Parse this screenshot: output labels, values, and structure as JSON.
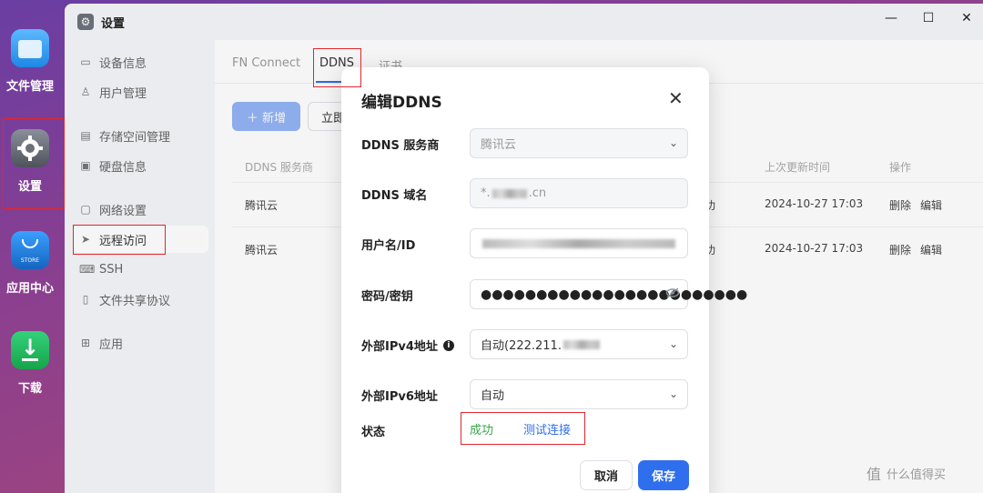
{
  "dock": {
    "apps": [
      {
        "label": "文件管理",
        "icon": "folder-icon"
      },
      {
        "label": "设置",
        "icon": "gear-icon"
      },
      {
        "label": "应用中心",
        "icon": "store-icon",
        "badge": "STORE"
      },
      {
        "label": "下载",
        "icon": "download-icon"
      }
    ]
  },
  "window": {
    "title": "设置",
    "controls": {
      "close": "✕",
      "maximize": "☐",
      "minimize": "—"
    }
  },
  "sidebar": {
    "items": [
      {
        "label": "设备信息",
        "icon": "monitor-icon"
      },
      {
        "label": "用户管理",
        "icon": "user-icon"
      },
      {
        "label": "存储空间管理",
        "icon": "storage-icon"
      },
      {
        "label": "硬盘信息",
        "icon": "disk-icon"
      },
      {
        "label": "网络设置",
        "icon": "network-icon"
      },
      {
        "label": "远程访问",
        "icon": "send-icon"
      },
      {
        "label": "SSH",
        "icon": "terminal-icon"
      },
      {
        "label": "文件共享协议",
        "icon": "document-icon"
      },
      {
        "label": "应用",
        "icon": "apps-grid-icon"
      }
    ],
    "active": "远程访问"
  },
  "tabs": [
    "FN Connect",
    "DDNS",
    "证书"
  ],
  "active_tab": "DDNS",
  "toolbar": {
    "add_label": "＋ 新增",
    "now_label": "立即"
  },
  "table": {
    "headers": [
      "DDNS 服务商",
      "上次更新时间",
      "操作"
    ],
    "rows": [
      {
        "provider": "腾讯云",
        "status_tail": "功",
        "updated": "2024-10-27 17:03",
        "delete": "删除",
        "edit": "编辑"
      },
      {
        "provider": "腾讯云",
        "status_tail": "功",
        "updated": "2024-10-27 17:03",
        "delete": "删除",
        "edit": "编辑"
      }
    ]
  },
  "modal": {
    "title": "编辑DDNS",
    "close": "✕",
    "fields": {
      "provider": {
        "label": "DDNS 服务商",
        "value": "腾讯云"
      },
      "domain": {
        "label": "DDNS 域名",
        "prefix": "*.",
        "suffix": ".cn"
      },
      "username": {
        "label": "用户名/ID"
      },
      "password": {
        "label": "密码/密钥",
        "value": "●●●●●●●●●●●●●●●●●●●●●●●●"
      },
      "ipv4": {
        "label": "外部IPv4地址",
        "info": "i",
        "value_prefix": "自动(222.211."
      },
      "ipv6": {
        "label": "外部IPv6地址",
        "value": "自动"
      },
      "status": {
        "label": "状态",
        "value": "成功",
        "test_link": "测试连接"
      }
    },
    "buttons": {
      "cancel": "取消",
      "save": "保存"
    }
  },
  "watermark": "什么值得买",
  "colors": {
    "accent": "#2f6fed",
    "success": "#3aa54a",
    "highlight": "#e3262e"
  }
}
